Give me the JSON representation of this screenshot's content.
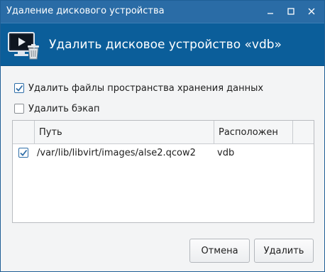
{
  "window": {
    "title": "Удаление дискового устройства"
  },
  "banner": {
    "title": "Удалить дисковое устройство «vdb»",
    "icon": "monitor-delete-icon"
  },
  "options": {
    "delete_storage_files": {
      "label": "Удалить файлы пространства хранения данных",
      "checked": true
    },
    "delete_backup": {
      "label": "Удалить бэкап",
      "checked": false
    }
  },
  "table": {
    "columns": [
      "",
      "Путь",
      "Расположен",
      ""
    ],
    "rows": [
      {
        "checked": true,
        "path": "/var/lib/libvirt/images/alse2.qcow2",
        "location": "vdb"
      }
    ]
  },
  "buttons": {
    "cancel": "Отмена",
    "delete": "Удалить"
  },
  "colors": {
    "titlebar": "#2a6ca6",
    "banner": "#0b5e9a",
    "accent": "#2f6ea8"
  }
}
